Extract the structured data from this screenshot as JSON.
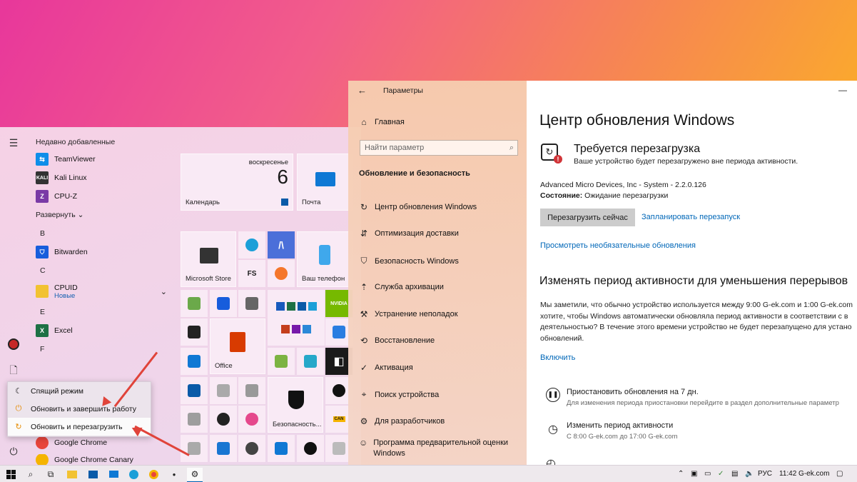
{
  "start_menu": {
    "recent_header": "Недавно добавленные",
    "recent": [
      {
        "label": "TeamViewer",
        "icon": "teamviewer-icon",
        "color": "#0e8ee9"
      },
      {
        "label": "Kali Linux",
        "icon": "kali-icon",
        "color": "#333333"
      },
      {
        "label": "CPU-Z",
        "icon": "cpuz-icon",
        "color": "#7a3aa6"
      }
    ],
    "expand": "Развернуть",
    "letters": {
      "b": "B",
      "c": "C",
      "e": "E",
      "f": "F"
    },
    "bitwarden": "Bitwarden",
    "cpuid": "CPUID",
    "cpuid_sub": "Новые",
    "excel": "Excel",
    "chrome": "Google Chrome",
    "chrome_canary": "Google Chrome Canary",
    "tiles": {
      "calendar_day": "воскресенье",
      "calendar_date": "6",
      "calendar": "Календарь",
      "mail": "Почта",
      "store": "Microsoft Store",
      "phone": "Ваш телефон",
      "office": "Office",
      "security": "Безопасность...",
      "nvidia": "NVIDIA",
      "can": "CAN",
      "fs": "FS"
    },
    "power_menu": [
      {
        "label": "Спящий режим",
        "icon": "moon-icon"
      },
      {
        "label": "Обновить и завершить работу",
        "icon": "update-shutdown-icon"
      },
      {
        "label": "Обновить и перезагрузить",
        "icon": "update-restart-icon"
      }
    ]
  },
  "settings": {
    "title": "Параметры",
    "home": "Главная",
    "search_placeholder": "Найти параметр",
    "section": "Обновление и безопасность",
    "nav": [
      "Центр обновления Windows",
      "Оптимизация доставки",
      "Безопасность Windows",
      "Служба архивации",
      "Устранение неполадок",
      "Восстановление",
      "Активация",
      "Поиск устройства",
      "Для разработчиков",
      "Программа предварительной оценки Windows"
    ],
    "page_title": "Центр обновления Windows",
    "status_title": "Требуется перезагрузка",
    "status_desc": "Ваше устройство будет перезагружено вне периода активности.",
    "update_name": "Advanced Micro Devices, Inc - System - 2.2.0.126",
    "state_label": "Состояние:",
    "state_value": "Ожидание перезагрузки",
    "restart_now": "Перезагрузить сейчас",
    "schedule": "Запланировать перезапуск",
    "optional": "Просмотреть необязательные обновления",
    "active_title": "Изменять период активности для уменьшения перерывов",
    "active_desc_1": "Мы заметили, что обычно устройство используется между 9:00 G-ek.com и 1:00 G-ek.com",
    "active_desc_2": "хотите, чтобы Windows автоматически обновляла период активности в соответствии с в",
    "active_desc_3": "деятельностью? В течение этого времени устройство не будет перезапущено для устано",
    "active_desc_4": "обновлений.",
    "enable": "Включить",
    "pause_title": "Приостановить обновления на 7 дн.",
    "pause_desc": "Для изменения периода приостановки перейдите в раздел дополнительные параметр",
    "hours_title": "Изменить период активности",
    "hours_desc": "С 8:00 G-ek.com до 17:00 G-ek.com"
  },
  "taskbar": {
    "lang": "РУС",
    "clock": "11:42 G-ek.com"
  },
  "colors": {
    "accent": "#0067b8",
    "arrow": "#e0433a",
    "excel": "#1e7145",
    "bitwarden": "#175ddc"
  }
}
